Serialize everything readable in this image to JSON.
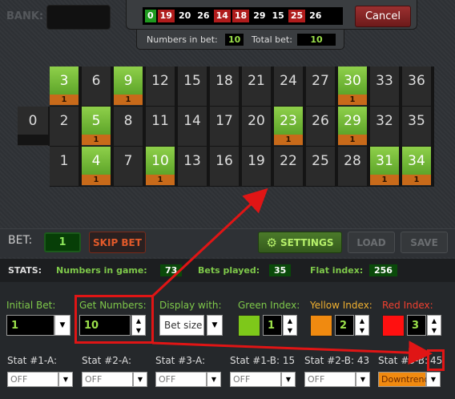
{
  "bank": {
    "label": "BANK:",
    "value": ""
  },
  "recent_numbers": [
    {
      "n": "0",
      "color": "green"
    },
    {
      "n": "19",
      "color": "red"
    },
    {
      "n": "20",
      "color": "black"
    },
    {
      "n": "26",
      "color": "black"
    },
    {
      "n": "14",
      "color": "red"
    },
    {
      "n": "18",
      "color": "red"
    },
    {
      "n": "29",
      "color": "black"
    },
    {
      "n": "15",
      "color": "black"
    },
    {
      "n": "25",
      "color": "red"
    },
    {
      "n": "26",
      "color": "black"
    }
  ],
  "cancel_label": "Cancel",
  "info": {
    "numbers_in_bet_label": "Numbers in bet:",
    "numbers_in_bet": "10",
    "total_bet_label": "Total bet:",
    "total_bet": "10"
  },
  "board": {
    "zero": "0",
    "rows": [
      [
        {
          "n": "3",
          "hit": true,
          "count": "1"
        },
        {
          "n": "6",
          "hit": false,
          "count": ""
        },
        {
          "n": "9",
          "hit": true,
          "count": "1"
        },
        {
          "n": "12",
          "hit": false,
          "count": ""
        },
        {
          "n": "15",
          "hit": false,
          "count": ""
        },
        {
          "n": "18",
          "hit": false,
          "count": ""
        },
        {
          "n": "21",
          "hit": false,
          "count": ""
        },
        {
          "n": "24",
          "hit": false,
          "count": ""
        },
        {
          "n": "27",
          "hit": false,
          "count": ""
        },
        {
          "n": "30",
          "hit": true,
          "count": "1"
        },
        {
          "n": "33",
          "hit": false,
          "count": ""
        },
        {
          "n": "36",
          "hit": false,
          "count": ""
        }
      ],
      [
        {
          "n": "2",
          "hit": false,
          "count": ""
        },
        {
          "n": "5",
          "hit": true,
          "count": "1"
        },
        {
          "n": "8",
          "hit": false,
          "count": ""
        },
        {
          "n": "11",
          "hit": false,
          "count": ""
        },
        {
          "n": "14",
          "hit": false,
          "count": ""
        },
        {
          "n": "17",
          "hit": false,
          "count": ""
        },
        {
          "n": "20",
          "hit": false,
          "count": ""
        },
        {
          "n": "23",
          "hit": true,
          "count": "1"
        },
        {
          "n": "26",
          "hit": false,
          "count": ""
        },
        {
          "n": "29",
          "hit": true,
          "count": "1"
        },
        {
          "n": "32",
          "hit": false,
          "count": ""
        },
        {
          "n": "35",
          "hit": false,
          "count": ""
        }
      ],
      [
        {
          "n": "1",
          "hit": false,
          "count": ""
        },
        {
          "n": "4",
          "hit": true,
          "count": "1"
        },
        {
          "n": "7",
          "hit": false,
          "count": ""
        },
        {
          "n": "10",
          "hit": true,
          "count": "1"
        },
        {
          "n": "13",
          "hit": false,
          "count": ""
        },
        {
          "n": "16",
          "hit": false,
          "count": ""
        },
        {
          "n": "19",
          "hit": false,
          "count": ""
        },
        {
          "n": "22",
          "hit": false,
          "count": ""
        },
        {
          "n": "25",
          "hit": false,
          "count": ""
        },
        {
          "n": "28",
          "hit": false,
          "count": ""
        },
        {
          "n": "31",
          "hit": true,
          "count": "1"
        },
        {
          "n": "34",
          "hit": true,
          "count": "1"
        }
      ]
    ]
  },
  "bet": {
    "label": "BET:",
    "value": "1"
  },
  "buttons": {
    "skip": "SKIP BET",
    "settings": "SETTINGS",
    "load": "LOAD",
    "save": "SAVE"
  },
  "stats": {
    "label": "STATS:",
    "numbers_in_game_label": "Numbers in game:",
    "numbers_in_game": "73",
    "bets_played_label": "Bets played:",
    "bets_played": "35",
    "flat_index_label": "Flat index:",
    "flat_index": "256"
  },
  "settings": {
    "initial_bet_label": "Initial Bet:",
    "initial_bet": "1",
    "get_numbers_label": "Get Numbers:",
    "get_numbers": "10",
    "display_with_label": "Display with:",
    "display_with": "Bet size",
    "green_index_label": "Green Index:",
    "green_index": "1",
    "yellow_index_label": "Yellow Index:",
    "yellow_index": "2",
    "red_index_label": "Red Index:",
    "red_index": "3",
    "colors": {
      "green": "#7ec81a",
      "yellow": "#f08a10",
      "red": "#ff1010"
    }
  },
  "stat_filters": [
    {
      "label": "Stat #1-A:",
      "value": "OFF"
    },
    {
      "label": "Stat #2-A:",
      "value": "OFF"
    },
    {
      "label": "Stat #3-A:",
      "value": "OFF"
    },
    {
      "label": "Stat #1-B: 15",
      "value": "OFF"
    },
    {
      "label": "Stat #2-B: 43",
      "value": "OFF"
    },
    {
      "label": "Stat #3-B:",
      "extra": "45",
      "value": "Downtrend"
    }
  ]
}
